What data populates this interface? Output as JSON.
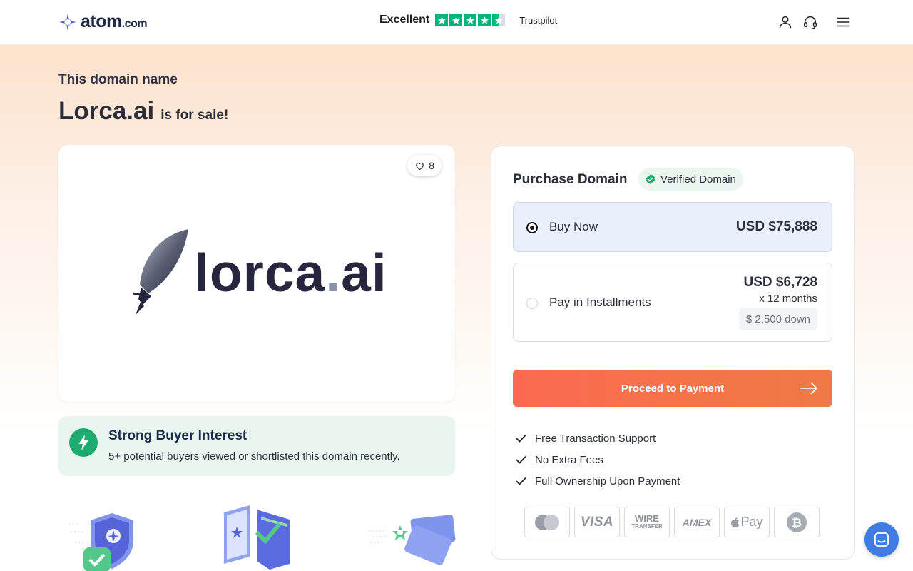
{
  "header": {
    "logo_main": "atom",
    "logo_suffix": ".com",
    "trust_rating": "Excellent",
    "trust_brand": "Trustpilot",
    "icons": [
      "user-icon",
      "headset-icon",
      "menu-icon"
    ]
  },
  "hero": {
    "kicker": "This domain name",
    "domain": "Lorca.ai",
    "for_sale": "is for sale!"
  },
  "logo_card": {
    "likes": "8",
    "brand_word_main": "lorca",
    "brand_word_dot": ".",
    "brand_word_tld": "ai"
  },
  "interest": {
    "title": "Strong Buyer Interest",
    "text": "5+ potential buyers viewed or shortlisted this domain recently."
  },
  "purchase": {
    "title": "Purchase Domain",
    "verified": "Verified Domain",
    "buy_now": {
      "label": "Buy Now",
      "price": "USD $75,888",
      "selected": true
    },
    "installments": {
      "label": "Pay in Installments",
      "price": "USD $6,728",
      "months": "x 12 months",
      "down": "$ 2,500 down",
      "selected": false
    },
    "cta": "Proceed to Payment",
    "benefits": [
      "Free Transaction Support",
      "No Extra Fees",
      "Full Ownership Upon Payment"
    ],
    "payment_methods": {
      "visa": "VISA",
      "wire_top": "WIRE",
      "wire_bottom": "TRANSFER",
      "amex": "AMEX",
      "apple": "Pay"
    }
  },
  "colors": {
    "accent": "#fb6a50",
    "trust_green": "#00b67a",
    "verified_green": "#1faa6f",
    "chat_blue": "#3f7de0"
  }
}
